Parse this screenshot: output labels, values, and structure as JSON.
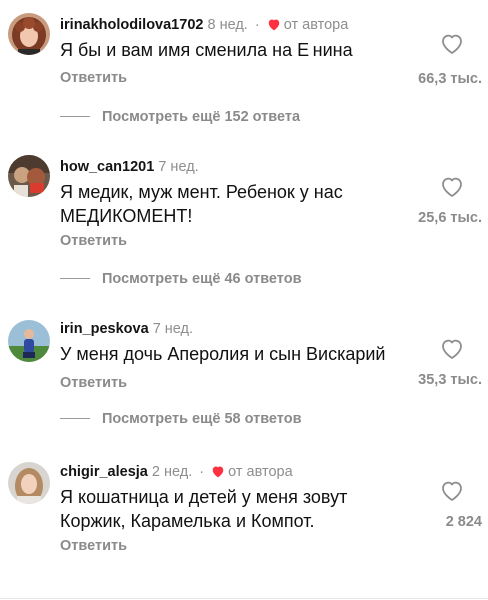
{
  "comments": [
    {
      "username": "irinakholodilova1702",
      "time": "8 нед.",
      "dot": "·",
      "author_badge": "от автора",
      "text": "Я бы и вам имя сменила на Е нина",
      "reply_label": "Ответить",
      "likes": "66,3 тыс.",
      "view_replies": "Посмотреть ещё 152 ответа"
    },
    {
      "username": "how_can1201",
      "time": "7 нед.",
      "text": "Я медик, муж мент. Ребенок у нас МЕДИКОМЕНТ!",
      "reply_label": "Ответить",
      "likes": "25,6 тыс.",
      "view_replies": "Посмотреть ещё 46 ответов"
    },
    {
      "username": "irin_peskova",
      "time": "7 нед.",
      "text": "У меня дочь Аперолия и сын Вискарий",
      "reply_label": "Ответить",
      "likes": "35,3 тыс.",
      "view_replies": "Посмотреть ещё 58 ответов"
    },
    {
      "username": "chigir_alesja",
      "time": "2 нед.",
      "dot": "·",
      "author_badge": "от автора",
      "text": "Я кошатница и детей у меня зовут Коржик, Карамелька и Компот.",
      "reply_label": "Ответить",
      "likes": "2 824"
    }
  ],
  "icons": {
    "like": "heart-outline-icon",
    "author_like": "heart-filled-icon"
  },
  "colors": {
    "author_heart": "#ff3040",
    "secondary_text": "#8e8e8e",
    "primary_text": "#111111"
  }
}
